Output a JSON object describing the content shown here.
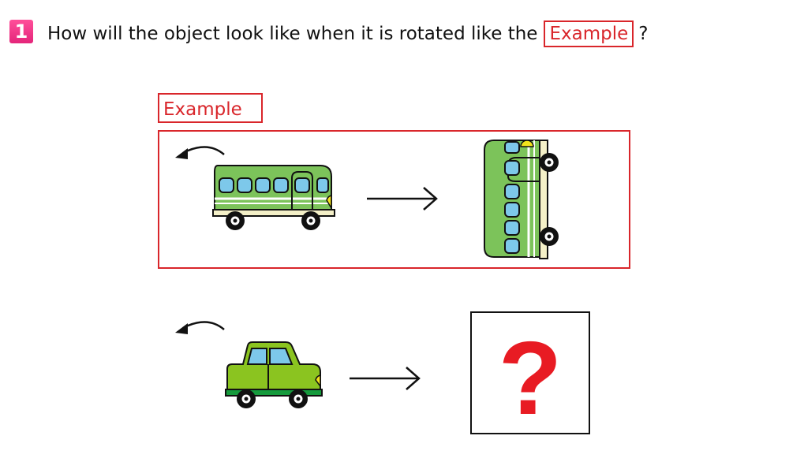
{
  "question": {
    "number": "1",
    "text_before": "How will the object look like when it is rotated like the",
    "tag": "Example",
    "text_after": "?"
  },
  "example": {
    "label": "Example"
  },
  "answer": {
    "symbol": "?"
  },
  "colors": {
    "accent_red": "#d9262b",
    "question_badge": "#e4257a",
    "bus_green": "#7cc35a",
    "car_green": "#8bc420",
    "window_blue": "#7dc8ea",
    "headlight_yellow": "#f2e31d"
  },
  "icons": {
    "rotate": "counterclockwise-arrow-icon",
    "transform": "right-arrow-icon"
  }
}
